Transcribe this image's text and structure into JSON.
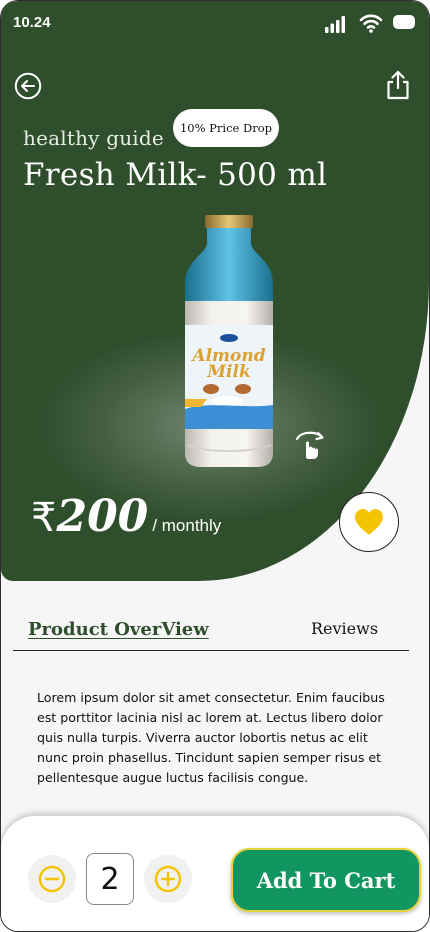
{
  "status_bar": {
    "time": "10.24",
    "icons": [
      "signal-icon",
      "wifi-icon",
      "battery-icon"
    ]
  },
  "header": {
    "back_icon": "back-arrow-icon",
    "share_icon": "share-icon"
  },
  "product": {
    "subtitle": "healthy guide",
    "badge": "10% Price Drop",
    "title": "Fresh Milk- 500 ml",
    "image": "almond-milk-bottle",
    "rotate_icon": "rotate-360-icon",
    "currency_symbol": "₹",
    "price": "200",
    "period": "/ monthly",
    "favorite_icon": "heart-icon"
  },
  "tabs": {
    "overview": "Product OverView",
    "reviews": "Reviews"
  },
  "description": "Lorem ipsum dolor sit amet consectetur. Enim faucibus est porttitor lacinia nisl ac lorem at. Lectus libero dolor quis nulla turpis. Viverra auctor lobortis netus ac elit nunc proin phasellus. Tincidunt sapien semper risus et pellentesque augue luctus facilisis congue.",
  "cart": {
    "quantity": "2",
    "minus_icon": "minus-circle-icon",
    "plus_icon": "plus-circle-icon",
    "add_label": "Add To Cart"
  },
  "colors": {
    "hero": "#2f4e2c",
    "accent_yellow": "#f2c500",
    "add_button": "#119662",
    "add_button_border": "#e7d23a"
  }
}
